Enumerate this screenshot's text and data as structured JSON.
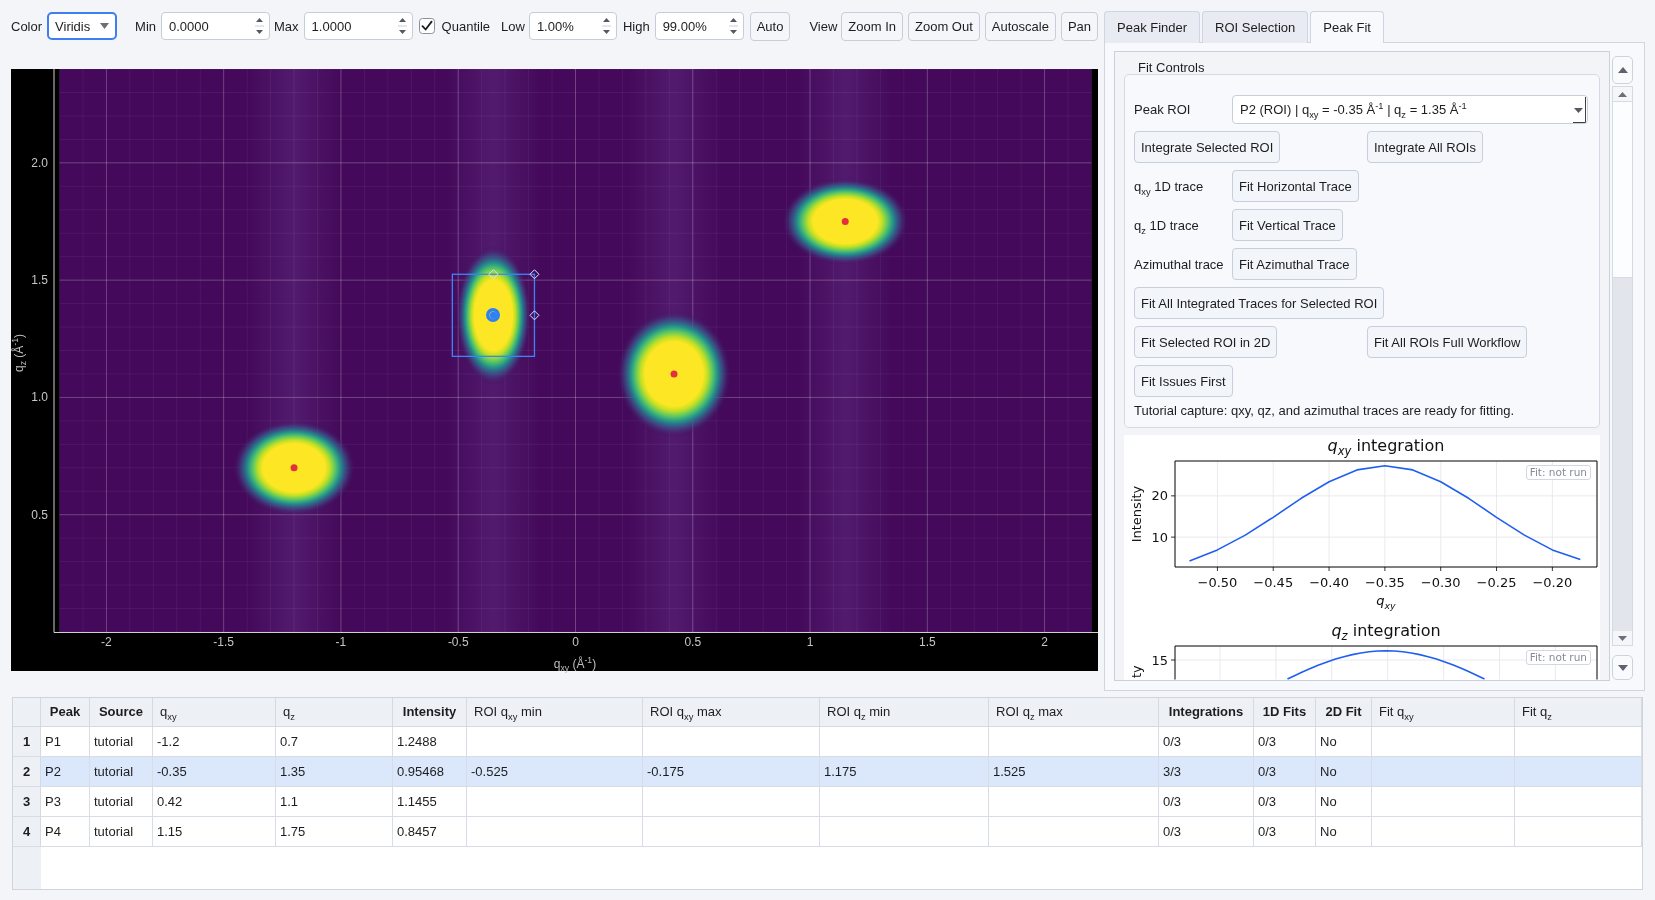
{
  "toolbar": {
    "color": {
      "label": "Color",
      "value": "Viridis"
    },
    "min": {
      "label": "Min",
      "value": "0.0000"
    },
    "max": {
      "label": "Max",
      "value": "1.0000"
    },
    "quantile": {
      "label": "Quantile",
      "checked": true
    },
    "low": {
      "label": "Low",
      "value": "1.00%"
    },
    "high": {
      "label": "High",
      "value": "99.00%"
    },
    "auto": "Auto",
    "view": {
      "label": "View",
      "buttons": [
        "Zoom In",
        "Zoom Out",
        "Autoscale",
        "Pan"
      ]
    }
  },
  "plot": {
    "chart_data": {
      "type": "scatter",
      "xlabel": "q$_{xy}$ (Å$^{-1}$)",
      "ylabel": "q$_{z}$ (Å$^{-1}$)",
      "x": [
        -1.2,
        -0.35,
        0.42,
        1.15
      ],
      "values": [
        0.7,
        1.35,
        1.1,
        1.75
      ],
      "xlim": [
        -2.2,
        2.2
      ],
      "ylim": [
        0,
        2.4
      ],
      "xticks": [
        -2,
        -1.5,
        -1,
        -0.5,
        0,
        0.5,
        1,
        1.5,
        2
      ],
      "yticks": [
        0.5,
        {
          "value": 1,
          "label": "1.0"
        },
        1.5,
        {
          "value": 2,
          "label": "2.0"
        }
      ],
      "grid": true
    }
  },
  "tabs": [
    {
      "label": "Peak Finder",
      "selected": false
    },
    {
      "label": "ROI Selection",
      "selected": false
    },
    {
      "label": "Peak Fit",
      "selected": true
    }
  ],
  "fit_controls": {
    "title": "Fit Controls",
    "peak_roi": {
      "label": "Peak ROI",
      "value": "P2 (ROI) | q$_{xy}$ = -0.35 Å$^{-1}$ | q$_{z}$ = 1.35 Å$^{-1}$"
    },
    "rows": [
      {
        "buttons": [
          "Integrate Selected ROI",
          "Integrate All ROIs"
        ]
      },
      {
        "label": "q$_{xy}$ 1D trace",
        "buttons": [
          "Fit Horizontal Trace"
        ]
      },
      {
        "label": "q$_{z}$ 1D trace",
        "buttons": [
          "Fit Vertical Trace"
        ]
      },
      {
        "label": "Azimuthal trace",
        "buttons": [
          "Fit Azimuthal Trace"
        ]
      },
      {
        "buttons": [
          "Fit All Integrated Traces for Selected ROI"
        ]
      },
      {
        "buttons": [
          "Fit Selected ROI in 2D",
          "Fit All ROIs Full Workflow"
        ]
      },
      {
        "buttons": [
          "Fit Issues First"
        ]
      }
    ],
    "status": "Tutorial capture: qxy, qz, and azimuthal traces are ready for fitting."
  },
  "charts": [
    {
      "kind": "chart",
      "fit_badge": "Fit: not run",
      "chart_data": {
        "type": "line",
        "title": "*q*$_{xy}$ integration",
        "xlabel": "q$_{xy}$",
        "ylabel": "Intensity",
        "x": [
          -0.525,
          -0.5,
          -0.475,
          -0.45,
          -0.425,
          -0.4,
          -0.375,
          -0.35,
          -0.325,
          -0.3,
          -0.275,
          -0.25,
          -0.225,
          -0.2,
          -0.175
        ],
        "values": [
          4.2,
          6.9,
          10.5,
          14.8,
          19.4,
          23.4,
          26.3,
          27.3,
          26.3,
          23.4,
          19.4,
          14.8,
          10.5,
          6.9,
          4.6
        ],
        "xlim": [
          -0.538,
          -0.16
        ],
        "ylim": [
          2.76,
          28.45
        ],
        "xticks": [
          {
            "value": -0.5,
            "label": "−0.50"
          },
          {
            "value": -0.45,
            "label": "−0.45"
          },
          {
            "value": -0.4,
            "label": "−0.40"
          },
          {
            "value": -0.35,
            "label": "−0.35"
          },
          {
            "value": -0.3,
            "label": "−0.30"
          },
          {
            "value": -0.25,
            "label": "−0.25"
          },
          {
            "value": -0.2,
            "label": "−0.20"
          }
        ],
        "yticks": [
          10,
          20
        ],
        "grid": true
      }
    },
    {
      "kind": "picture",
      "title": "*q*$_{z}$ integration",
      "fit_badge": "Fit: not run",
      "tick_label": "15",
      "ylabel": "ty"
    }
  ],
  "table": {
    "columns": [
      {
        "label": "Peak",
        "kind": "bold"
      },
      {
        "label": "Source",
        "kind": "bold"
      },
      {
        "label": "q$_{xy}$",
        "kind": "plain"
      },
      {
        "label": "q$_{z}$",
        "kind": "plain"
      },
      {
        "label": "Intensity",
        "kind": "bold"
      },
      {
        "label": "ROI q$_{xy}$ min",
        "kind": "plain"
      },
      {
        "label": "ROI q$_{xy}$ max",
        "kind": "plain"
      },
      {
        "label": "ROI q$_{z}$ min",
        "kind": "plain"
      },
      {
        "label": "ROI q$_{z}$ max",
        "kind": "plain"
      },
      {
        "label": "Integrations",
        "kind": "bold"
      },
      {
        "label": "1D Fits",
        "kind": "bold"
      },
      {
        "label": "2D Fit",
        "kind": "bold"
      },
      {
        "label": "Fit q$_{xy}$",
        "kind": "plain"
      },
      {
        "label": "Fit q$_{z}$",
        "kind": "plain"
      }
    ],
    "rows": [
      {
        "number": "1",
        "selected": false,
        "cells": [
          "P1",
          "tutorial",
          "-1.2",
          "0.7",
          "1.2488",
          null,
          null,
          null,
          null,
          "0/3",
          "0/3",
          "No",
          null,
          null
        ]
      },
      {
        "number": "2",
        "selected": true,
        "cells": [
          "P2",
          "tutorial",
          "-0.35",
          "1.35",
          "0.95468",
          "-0.525",
          "-0.175",
          "1.175",
          "1.525",
          "3/3",
          "0/3",
          "No",
          null,
          null
        ]
      },
      {
        "number": "3",
        "selected": false,
        "cells": [
          "P3",
          "tutorial",
          "0.42",
          "1.1",
          "1.1455",
          null,
          null,
          null,
          null,
          "0/3",
          "0/3",
          "No",
          null,
          null
        ]
      },
      {
        "number": "4",
        "selected": false,
        "cells": [
          "P4",
          "tutorial",
          "1.15",
          "1.75",
          "0.8457",
          null,
          null,
          null,
          null,
          "0/3",
          "0/3",
          "No",
          null,
          null
        ]
      }
    ]
  }
}
